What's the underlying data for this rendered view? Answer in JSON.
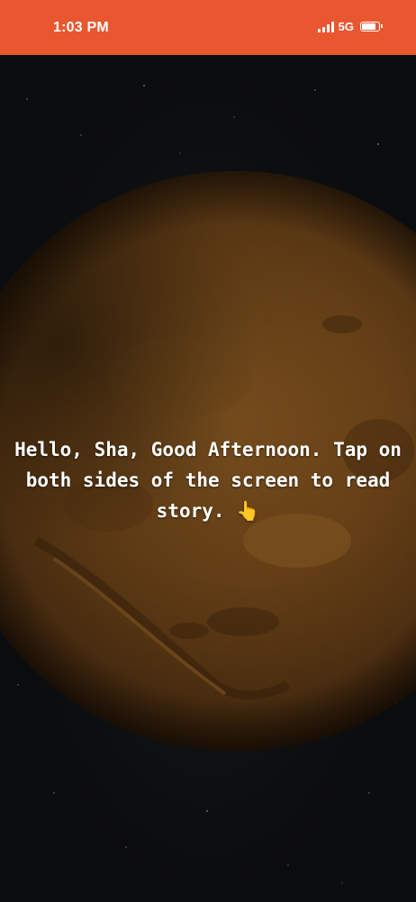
{
  "status_bar": {
    "time": "1:03 PM",
    "network": "5G",
    "signal_icon": "signal-bars-icon",
    "battery_icon": "battery-icon",
    "battery_level": 0.9,
    "background_color": "#e8572f"
  },
  "story": {
    "message": "Hello, Sha, Good Afternoon. Tap on both sides of the screen to read story.",
    "pointer_emoji": "👆",
    "background_image": "mars-planet"
  }
}
